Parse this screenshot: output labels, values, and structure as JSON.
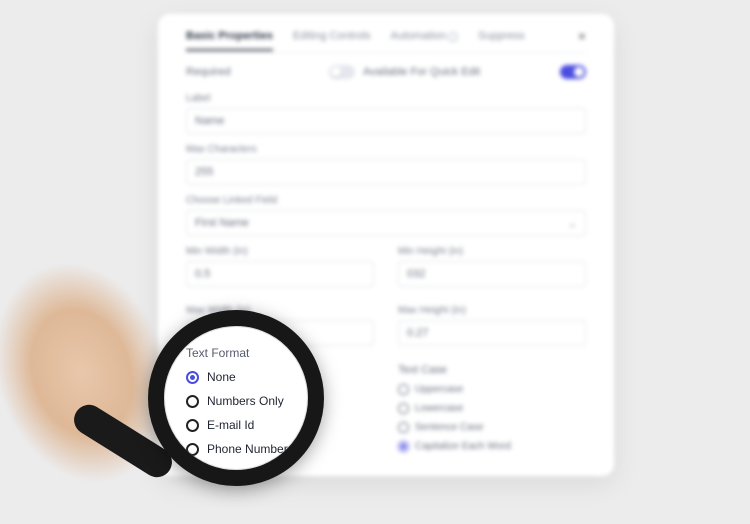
{
  "tabs": {
    "basic": "Basic Properties",
    "editing": "Editing Controls",
    "automation": "Automation",
    "suppress": "Suppress"
  },
  "toggles": {
    "required": "Required",
    "quick_edit": "Available For Quick Edit"
  },
  "fields": {
    "label_l": "Label",
    "label_v": "Name",
    "maxchar_l": "Max Characters",
    "maxchar_v": "255",
    "linked_l": "Choose Linked Field",
    "linked_v": "First Name",
    "minw_l": "Min Width (in)",
    "minw_v": "0.5",
    "minh_l": "Min Height (in)",
    "minh_v": "032",
    "maxw_l": "Max Width (in)",
    "maxw_v": "",
    "maxh_l": "Max Height (in)",
    "maxh_v": "0.27"
  },
  "text_format": {
    "title": "Text Format",
    "none": "None",
    "numbers": "Numbers Only",
    "email": "E-mail Id",
    "phone": "Phone Number"
  },
  "text_case": {
    "title": "Text Case",
    "upper": "Uppercase",
    "lower": "Lowercase",
    "sentence": "Sentence Case",
    "cap": "Capitalize Each Word"
  }
}
